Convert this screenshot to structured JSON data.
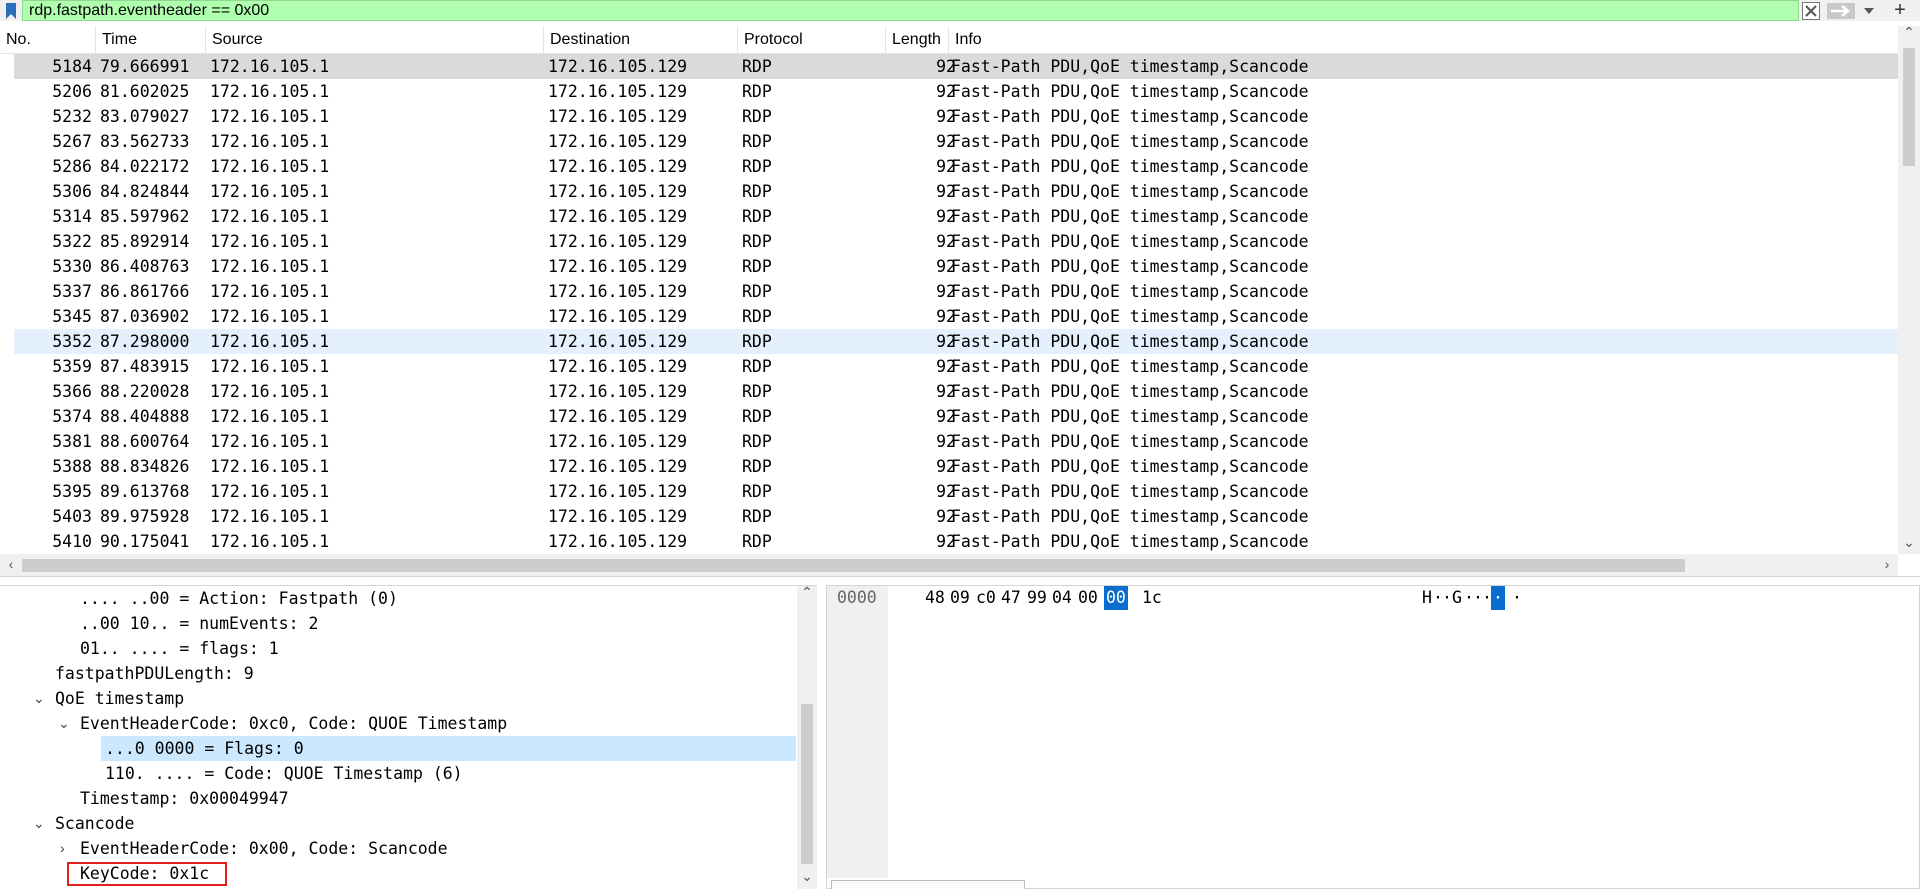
{
  "filter": {
    "value": "rdp.fastpath.eventheader == 0x00"
  },
  "columns": {
    "no": "No.",
    "time": "Time",
    "source": "Source",
    "destination": "Destination",
    "protocol": "Protocol",
    "length": "Length",
    "info": "Info"
  },
  "packets": [
    {
      "no": "5184",
      "time": "79.666991",
      "src": "172.16.105.1",
      "dst": "172.16.105.129",
      "proto": "RDP",
      "len": "92",
      "info": "Fast-Path PDU,QoE timestamp,Scancode"
    },
    {
      "no": "5206",
      "time": "81.602025",
      "src": "172.16.105.1",
      "dst": "172.16.105.129",
      "proto": "RDP",
      "len": "92",
      "info": "Fast-Path PDU,QoE timestamp,Scancode"
    },
    {
      "no": "5232",
      "time": "83.079027",
      "src": "172.16.105.1",
      "dst": "172.16.105.129",
      "proto": "RDP",
      "len": "92",
      "info": "Fast-Path PDU,QoE timestamp,Scancode"
    },
    {
      "no": "5267",
      "time": "83.562733",
      "src": "172.16.105.1",
      "dst": "172.16.105.129",
      "proto": "RDP",
      "len": "92",
      "info": "Fast-Path PDU,QoE timestamp,Scancode"
    },
    {
      "no": "5286",
      "time": "84.022172",
      "src": "172.16.105.1",
      "dst": "172.16.105.129",
      "proto": "RDP",
      "len": "92",
      "info": "Fast-Path PDU,QoE timestamp,Scancode"
    },
    {
      "no": "5306",
      "time": "84.824844",
      "src": "172.16.105.1",
      "dst": "172.16.105.129",
      "proto": "RDP",
      "len": "92",
      "info": "Fast-Path PDU,QoE timestamp,Scancode"
    },
    {
      "no": "5314",
      "time": "85.597962",
      "src": "172.16.105.1",
      "dst": "172.16.105.129",
      "proto": "RDP",
      "len": "92",
      "info": "Fast-Path PDU,QoE timestamp,Scancode"
    },
    {
      "no": "5322",
      "time": "85.892914",
      "src": "172.16.105.1",
      "dst": "172.16.105.129",
      "proto": "RDP",
      "len": "92",
      "info": "Fast-Path PDU,QoE timestamp,Scancode"
    },
    {
      "no": "5330",
      "time": "86.408763",
      "src": "172.16.105.1",
      "dst": "172.16.105.129",
      "proto": "RDP",
      "len": "92",
      "info": "Fast-Path PDU,QoE timestamp,Scancode"
    },
    {
      "no": "5337",
      "time": "86.861766",
      "src": "172.16.105.1",
      "dst": "172.16.105.129",
      "proto": "RDP",
      "len": "92",
      "info": "Fast-Path PDU,QoE timestamp,Scancode"
    },
    {
      "no": "5345",
      "time": "87.036902",
      "src": "172.16.105.1",
      "dst": "172.16.105.129",
      "proto": "RDP",
      "len": "92",
      "info": "Fast-Path PDU,QoE timestamp,Scancode"
    },
    {
      "no": "5352",
      "time": "87.298000",
      "src": "172.16.105.1",
      "dst": "172.16.105.129",
      "proto": "RDP",
      "len": "92",
      "info": "Fast-Path PDU,QoE timestamp,Scancode"
    },
    {
      "no": "5359",
      "time": "87.483915",
      "src": "172.16.105.1",
      "dst": "172.16.105.129",
      "proto": "RDP",
      "len": "92",
      "info": "Fast-Path PDU,QoE timestamp,Scancode"
    },
    {
      "no": "5366",
      "time": "88.220028",
      "src": "172.16.105.1",
      "dst": "172.16.105.129",
      "proto": "RDP",
      "len": "92",
      "info": "Fast-Path PDU,QoE timestamp,Scancode"
    },
    {
      "no": "5374",
      "time": "88.404888",
      "src": "172.16.105.1",
      "dst": "172.16.105.129",
      "proto": "RDP",
      "len": "92",
      "info": "Fast-Path PDU,QoE timestamp,Scancode"
    },
    {
      "no": "5381",
      "time": "88.600764",
      "src": "172.16.105.1",
      "dst": "172.16.105.129",
      "proto": "RDP",
      "len": "92",
      "info": "Fast-Path PDU,QoE timestamp,Scancode"
    },
    {
      "no": "5388",
      "time": "88.834826",
      "src": "172.16.105.1",
      "dst": "172.16.105.129",
      "proto": "RDP",
      "len": "92",
      "info": "Fast-Path PDU,QoE timestamp,Scancode"
    },
    {
      "no": "5395",
      "time": "89.613768",
      "src": "172.16.105.1",
      "dst": "172.16.105.129",
      "proto": "RDP",
      "len": "92",
      "info": "Fast-Path PDU,QoE timestamp,Scancode"
    },
    {
      "no": "5403",
      "time": "89.975928",
      "src": "172.16.105.1",
      "dst": "172.16.105.129",
      "proto": "RDP",
      "len": "92",
      "info": "Fast-Path PDU,QoE timestamp,Scancode"
    },
    {
      "no": "5410",
      "time": "90.175041",
      "src": "172.16.105.1",
      "dst": "172.16.105.129",
      "proto": "RDP",
      "len": "92",
      "info": "Fast-Path PDU,QoE timestamp,Scancode"
    }
  ],
  "details": [
    {
      "text": ".... ..00 = Action: Fastpath (0)"
    },
    {
      "text": "..00 10.. = numEvents: 2"
    },
    {
      "text": "01.. .... = flags: 1"
    },
    {
      "text": "fastpathPDULength: 9"
    },
    {
      "text": "QoE timestamp"
    },
    {
      "text": "EventHeaderCode: 0xc0, Code: QUOE Timestamp"
    },
    {
      "text": "...0 0000 = Flags: 0"
    },
    {
      "text": "110. .... = Code: QUOE Timestamp (6)"
    },
    {
      "text": "Timestamp: 0x00049947"
    },
    {
      "text": "Scancode"
    },
    {
      "text": "EventHeaderCode: 0x00, Code: Scancode"
    },
    {
      "text": "KeyCode: 0x1c"
    }
  ],
  "bytes": {
    "offset": "0000",
    "hex": [
      "48",
      "09",
      "c0",
      "47",
      "99",
      "04",
      "00",
      "00",
      "1c"
    ],
    "ascii": [
      "H",
      "·",
      "·",
      "G",
      "·",
      "·",
      "·",
      "·",
      "·"
    ]
  }
}
